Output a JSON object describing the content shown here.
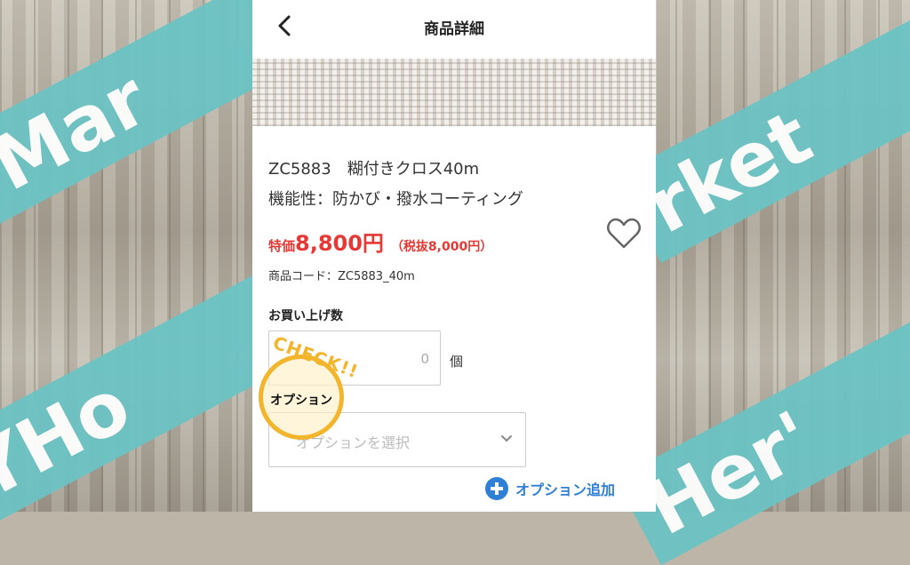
{
  "background": {
    "stripe_texts": [
      "s Mar",
      "rket",
      "MYHo",
      "Her'"
    ],
    "stripe_color": "#6cc3c4"
  },
  "header": {
    "title": "商品詳細",
    "back_icon": "chevron-left-icon"
  },
  "product": {
    "name_line1": "ZC5883　糊付きクロス40m",
    "name_line2": "機能性：防かび・撥水コーティング",
    "price_label": "特価",
    "price_value": "8,800円",
    "price_tax": "（税抜8,000円）",
    "code": "商品コード：ZC5883_40m",
    "favorite_icon": "heart-icon",
    "price_color": "#e53935"
  },
  "quantity": {
    "label": "お買い上げ数",
    "value": "0",
    "unit": "個"
  },
  "option": {
    "label": "オプション",
    "placeholder": "オプションを選択",
    "add_label": "オプション追加",
    "accent": "#2f7fd6"
  },
  "callout": {
    "text": "CHECK!!",
    "color": "#f2b52b"
  }
}
